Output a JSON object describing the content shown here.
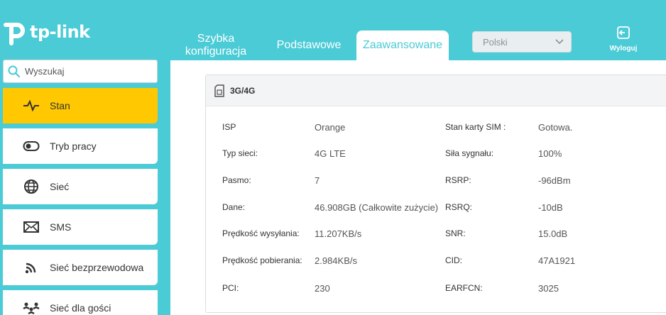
{
  "brand": {
    "name": "tp-link"
  },
  "tabs": {
    "quick_line1": "Szybka",
    "quick_line2": "konfiguracja",
    "basic": "Podstawowe",
    "advanced": "Zaawansowane"
  },
  "language": {
    "selected": "Polski"
  },
  "logout": {
    "label": "Wyloguj"
  },
  "search": {
    "placeholder": "Wyszukaj"
  },
  "sidebar": {
    "items": [
      {
        "label": "Stan",
        "icon": "pulse-icon",
        "active": true
      },
      {
        "label": "Tryb pracy",
        "icon": "toggle-icon",
        "active": false
      },
      {
        "label": "Sieć",
        "icon": "globe-icon",
        "active": false
      },
      {
        "label": "SMS",
        "icon": "envelope-icon",
        "active": false
      },
      {
        "label": "Sieć bezprzewodowa",
        "icon": "wifi-icon",
        "active": false
      },
      {
        "label": "Sieć dla gości",
        "icon": "guests-icon",
        "active": false
      }
    ]
  },
  "panel": {
    "title": "3G/4G",
    "left": [
      {
        "label": "ISP",
        "value": "Orange"
      },
      {
        "label": "Typ sieci:",
        "value": "4G LTE"
      },
      {
        "label": "Pasmo:",
        "value": "7"
      },
      {
        "label": "Dane:",
        "value": "46.908GB (Całkowite zużycie)"
      },
      {
        "label": "Prędkość wysyłania:",
        "value": "11.207KB/s"
      },
      {
        "label": "Prędkość pobierania:",
        "value": "2.984KB/s"
      },
      {
        "label": "PCI:",
        "value": "230"
      }
    ],
    "right": [
      {
        "label": "Stan karty SIM :",
        "value": "Gotowa."
      },
      {
        "label": "Siła sygnału:",
        "value": "100%"
      },
      {
        "label": "RSRP:",
        "value": "-96dBm"
      },
      {
        "label": "RSRQ:",
        "value": "-10dB"
      },
      {
        "label": "SNR:",
        "value": "15.0dB"
      },
      {
        "label": "CID:",
        "value": "47A1921"
      },
      {
        "label": "EARFCN:",
        "value": "3025"
      }
    ]
  },
  "colors": {
    "accent": "#4acbd6",
    "active": "#ffc800"
  }
}
